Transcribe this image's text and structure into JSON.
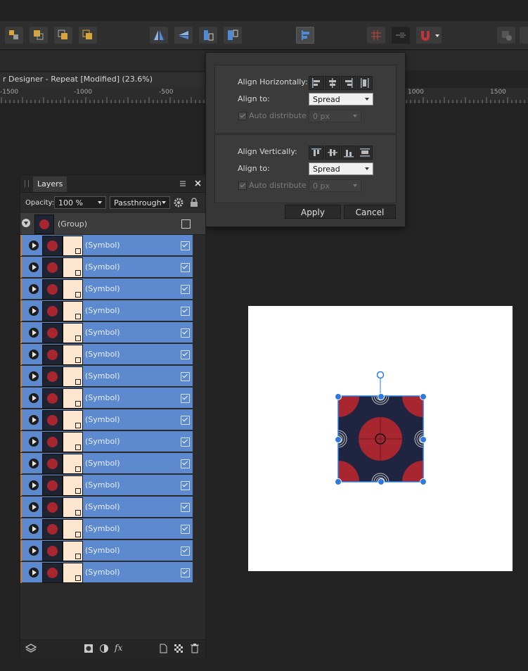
{
  "document": {
    "title": "r Designer - Repeat [Modified] (23.6%)"
  },
  "ruler": {
    "labels": [
      "-1500",
      "-1000",
      "-500",
      "1000",
      "1500"
    ]
  },
  "align_dialog": {
    "horizontal": {
      "label": "Align Horizontally:",
      "buttons": [
        "align-left",
        "align-center",
        "align-right",
        "space-evenly-horizontal"
      ],
      "align_to_label": "Align to:",
      "align_to_value": "Spread",
      "auto_distribute_label": "Auto distribute",
      "auto_distribute_checked": true,
      "spacing_value": "0 px"
    },
    "vertical": {
      "label": "Align Vertically:",
      "buttons": [
        "align-top",
        "align-middle",
        "align-bottom",
        "space-evenly-vertical"
      ],
      "align_to_label": "Align to:",
      "align_to_value": "Spread",
      "auto_distribute_label": "Auto distribute",
      "auto_distribute_checked": true,
      "spacing_value": "0 px"
    },
    "apply_label": "Apply",
    "cancel_label": "Cancel"
  },
  "layers_panel": {
    "tab": "Layers",
    "opacity_label": "Opacity:",
    "opacity_value": "100 %",
    "blend_mode": "Passthrough",
    "group_row": {
      "name": "(Group)",
      "visible": true
    },
    "rows": [
      {
        "name": "(Symbol)",
        "visible": true
      },
      {
        "name": "(Symbol)",
        "visible": true
      },
      {
        "name": "(Symbol)",
        "visible": true
      },
      {
        "name": "(Symbol)",
        "visible": true
      },
      {
        "name": "(Symbol)",
        "visible": true
      },
      {
        "name": "(Symbol)",
        "visible": true
      },
      {
        "name": "(Symbol)",
        "visible": true
      },
      {
        "name": "(Symbol)",
        "visible": true
      },
      {
        "name": "(Symbol)",
        "visible": true
      },
      {
        "name": "(Symbol)",
        "visible": true
      },
      {
        "name": "(Symbol)",
        "visible": true
      },
      {
        "name": "(Symbol)",
        "visible": true
      },
      {
        "name": "(Symbol)",
        "visible": true
      },
      {
        "name": "(Symbol)",
        "visible": true
      },
      {
        "name": "(Symbol)",
        "visible": true
      },
      {
        "name": "(Symbol)",
        "visible": true
      }
    ],
    "footer_icons": [
      "layers-stack-icon",
      "mask-icon",
      "adjustment-icon",
      "fx-icon",
      "new-layer-icon",
      "pixel-layer-icon",
      "delete-icon"
    ],
    "footer_fx_label": "fx"
  },
  "colors": {
    "selection_blue": "#5d8acf",
    "accent_orange": "#d97a2a",
    "pattern_navy": "#1f2540",
    "pattern_red": "#a8262f",
    "handle_blue": "#2d7be0"
  }
}
